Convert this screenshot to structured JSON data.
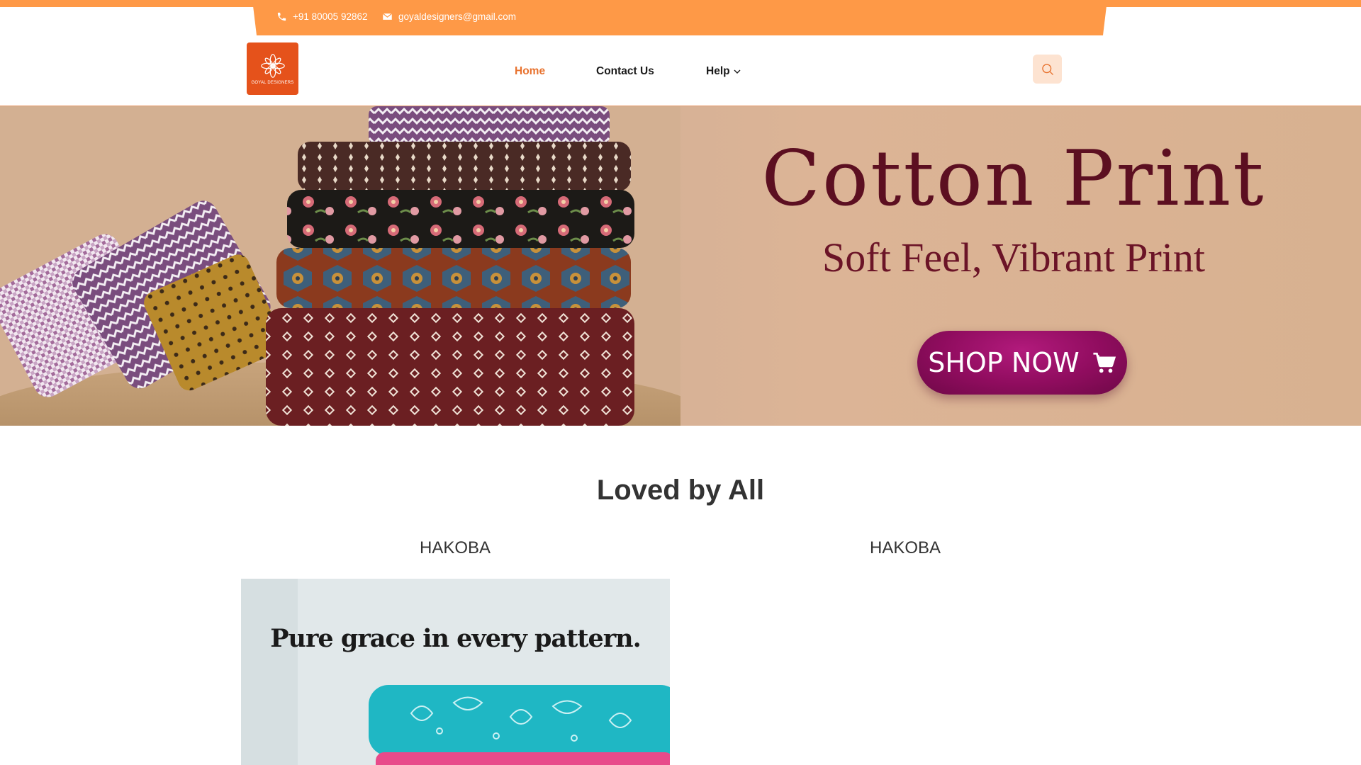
{
  "topbar": {
    "phone": "+91 80005 92862",
    "email": "goyaldesigners@gmail.com",
    "phone_icon": "phone-icon",
    "email_icon": "envelope-icon",
    "color": "#fe9947"
  },
  "header": {
    "logo_text": "GOYAL DESIGNERS",
    "logo_color": "#e5521b",
    "nav": {
      "home": "Home",
      "contact": "Contact Us",
      "help": "Help"
    },
    "search_icon": "search-icon",
    "accent": "#e8722e"
  },
  "banner": {
    "title": "Cotton Print",
    "subtitle": "Soft Feel, Vibrant Print",
    "cta": "SHOP NOW",
    "cta_icon": "cart-icon"
  },
  "section": {
    "title": "Loved by All",
    "categories": [
      "HAKOBA",
      "HAKOBA"
    ]
  },
  "product": {
    "caption": "Pure grace in every pattern."
  }
}
